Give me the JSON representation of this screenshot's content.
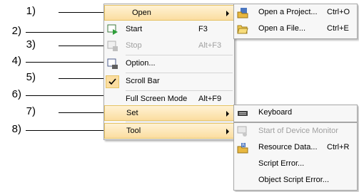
{
  "callouts": [
    "1)",
    "2)",
    "3)",
    "4)",
    "5)",
    "6)",
    "7)",
    "8)"
  ],
  "main_menu": {
    "open": "Open",
    "start": "Start",
    "start_sc": "F3",
    "stop": "Stop",
    "stop_sc": "Alt+F3",
    "option": "Option...",
    "scroll_bar": "Scroll Bar",
    "full_screen": "Full Screen Mode",
    "full_screen_sc": "Alt+F9",
    "set": "Set",
    "tool": "Tool"
  },
  "open_menu": {
    "open_project": "Open a Project...",
    "open_project_sc": "Ctrl+O",
    "open_file": "Open a File...",
    "open_file_sc": "Ctrl+E"
  },
  "set_menu": {
    "keyboard": "Keyboard"
  },
  "tool_menu": {
    "device_monitor": "Start of Device Monitor",
    "resource_data": "Resource Data...",
    "resource_data_sc": "Ctrl+R",
    "script_error": "Script Error...",
    "object_script_error": "Object Script Error..."
  },
  "colors": {
    "highlight": "#fbdda0",
    "highlight_border": "#e5c365",
    "menu_bg": "#f7f7f7"
  }
}
